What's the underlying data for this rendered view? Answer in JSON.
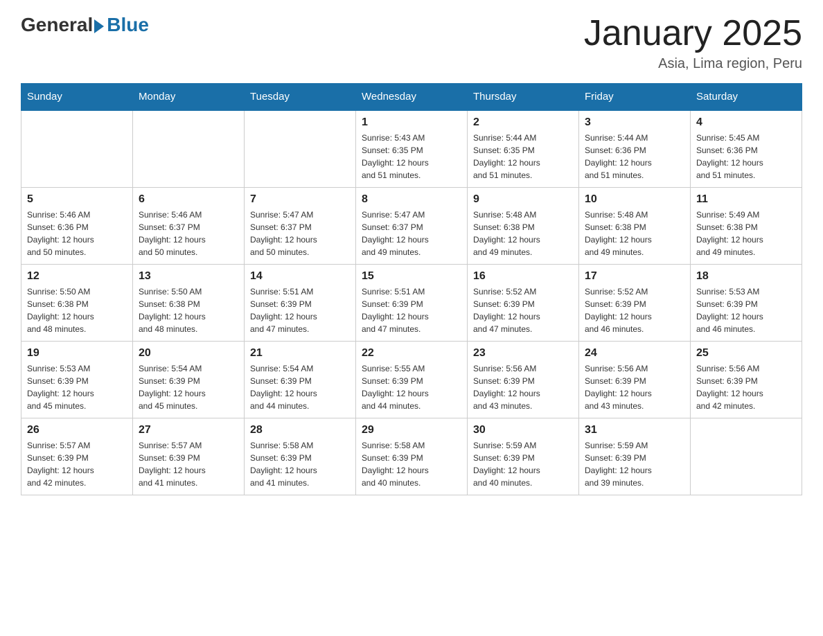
{
  "logo": {
    "general": "General",
    "blue": "Blue"
  },
  "title": "January 2025",
  "location": "Asia, Lima region, Peru",
  "days_header": [
    "Sunday",
    "Monday",
    "Tuesday",
    "Wednesday",
    "Thursday",
    "Friday",
    "Saturday"
  ],
  "weeks": [
    [
      {
        "day": "",
        "info": ""
      },
      {
        "day": "",
        "info": ""
      },
      {
        "day": "",
        "info": ""
      },
      {
        "day": "1",
        "info": "Sunrise: 5:43 AM\nSunset: 6:35 PM\nDaylight: 12 hours\nand 51 minutes."
      },
      {
        "day": "2",
        "info": "Sunrise: 5:44 AM\nSunset: 6:35 PM\nDaylight: 12 hours\nand 51 minutes."
      },
      {
        "day": "3",
        "info": "Sunrise: 5:44 AM\nSunset: 6:36 PM\nDaylight: 12 hours\nand 51 minutes."
      },
      {
        "day": "4",
        "info": "Sunrise: 5:45 AM\nSunset: 6:36 PM\nDaylight: 12 hours\nand 51 minutes."
      }
    ],
    [
      {
        "day": "5",
        "info": "Sunrise: 5:46 AM\nSunset: 6:36 PM\nDaylight: 12 hours\nand 50 minutes."
      },
      {
        "day": "6",
        "info": "Sunrise: 5:46 AM\nSunset: 6:37 PM\nDaylight: 12 hours\nand 50 minutes."
      },
      {
        "day": "7",
        "info": "Sunrise: 5:47 AM\nSunset: 6:37 PM\nDaylight: 12 hours\nand 50 minutes."
      },
      {
        "day": "8",
        "info": "Sunrise: 5:47 AM\nSunset: 6:37 PM\nDaylight: 12 hours\nand 49 minutes."
      },
      {
        "day": "9",
        "info": "Sunrise: 5:48 AM\nSunset: 6:38 PM\nDaylight: 12 hours\nand 49 minutes."
      },
      {
        "day": "10",
        "info": "Sunrise: 5:48 AM\nSunset: 6:38 PM\nDaylight: 12 hours\nand 49 minutes."
      },
      {
        "day": "11",
        "info": "Sunrise: 5:49 AM\nSunset: 6:38 PM\nDaylight: 12 hours\nand 49 minutes."
      }
    ],
    [
      {
        "day": "12",
        "info": "Sunrise: 5:50 AM\nSunset: 6:38 PM\nDaylight: 12 hours\nand 48 minutes."
      },
      {
        "day": "13",
        "info": "Sunrise: 5:50 AM\nSunset: 6:38 PM\nDaylight: 12 hours\nand 48 minutes."
      },
      {
        "day": "14",
        "info": "Sunrise: 5:51 AM\nSunset: 6:39 PM\nDaylight: 12 hours\nand 47 minutes."
      },
      {
        "day": "15",
        "info": "Sunrise: 5:51 AM\nSunset: 6:39 PM\nDaylight: 12 hours\nand 47 minutes."
      },
      {
        "day": "16",
        "info": "Sunrise: 5:52 AM\nSunset: 6:39 PM\nDaylight: 12 hours\nand 47 minutes."
      },
      {
        "day": "17",
        "info": "Sunrise: 5:52 AM\nSunset: 6:39 PM\nDaylight: 12 hours\nand 46 minutes."
      },
      {
        "day": "18",
        "info": "Sunrise: 5:53 AM\nSunset: 6:39 PM\nDaylight: 12 hours\nand 46 minutes."
      }
    ],
    [
      {
        "day": "19",
        "info": "Sunrise: 5:53 AM\nSunset: 6:39 PM\nDaylight: 12 hours\nand 45 minutes."
      },
      {
        "day": "20",
        "info": "Sunrise: 5:54 AM\nSunset: 6:39 PM\nDaylight: 12 hours\nand 45 minutes."
      },
      {
        "day": "21",
        "info": "Sunrise: 5:54 AM\nSunset: 6:39 PM\nDaylight: 12 hours\nand 44 minutes."
      },
      {
        "day": "22",
        "info": "Sunrise: 5:55 AM\nSunset: 6:39 PM\nDaylight: 12 hours\nand 44 minutes."
      },
      {
        "day": "23",
        "info": "Sunrise: 5:56 AM\nSunset: 6:39 PM\nDaylight: 12 hours\nand 43 minutes."
      },
      {
        "day": "24",
        "info": "Sunrise: 5:56 AM\nSunset: 6:39 PM\nDaylight: 12 hours\nand 43 minutes."
      },
      {
        "day": "25",
        "info": "Sunrise: 5:56 AM\nSunset: 6:39 PM\nDaylight: 12 hours\nand 42 minutes."
      }
    ],
    [
      {
        "day": "26",
        "info": "Sunrise: 5:57 AM\nSunset: 6:39 PM\nDaylight: 12 hours\nand 42 minutes."
      },
      {
        "day": "27",
        "info": "Sunrise: 5:57 AM\nSunset: 6:39 PM\nDaylight: 12 hours\nand 41 minutes."
      },
      {
        "day": "28",
        "info": "Sunrise: 5:58 AM\nSunset: 6:39 PM\nDaylight: 12 hours\nand 41 minutes."
      },
      {
        "day": "29",
        "info": "Sunrise: 5:58 AM\nSunset: 6:39 PM\nDaylight: 12 hours\nand 40 minutes."
      },
      {
        "day": "30",
        "info": "Sunrise: 5:59 AM\nSunset: 6:39 PM\nDaylight: 12 hours\nand 40 minutes."
      },
      {
        "day": "31",
        "info": "Sunrise: 5:59 AM\nSunset: 6:39 PM\nDaylight: 12 hours\nand 39 minutes."
      },
      {
        "day": "",
        "info": ""
      }
    ]
  ]
}
